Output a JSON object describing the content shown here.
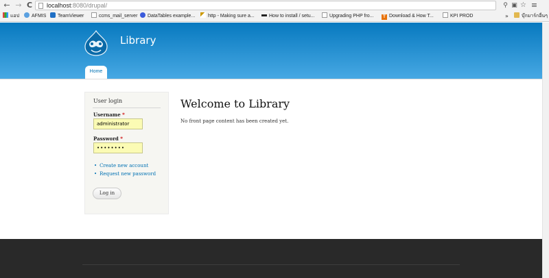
{
  "browser": {
    "url_host": "localhost",
    "url_path": ":8080/drupal/",
    "back_icon": "←",
    "forward_icon": "→",
    "reload_icon": "C",
    "menu_icon": "≡",
    "star_icon": "☆"
  },
  "bookmarks": {
    "items": [
      {
        "label": "แอป",
        "icon": "apps-icon"
      },
      {
        "label": "AFMIS",
        "icon": "drop-icon"
      },
      {
        "label": "TeamViewer",
        "icon": "teamviewer-icon"
      },
      {
        "label": "ccms_mail_server",
        "icon": "page-icon"
      },
      {
        "label": "DataTables example...",
        "icon": "globe-icon"
      },
      {
        "label": "http - Making sure a...",
        "icon": "pen-icon"
      },
      {
        "label": "How to install / setu...",
        "icon": "bar-icon"
      },
      {
        "label": "Upgrading PHP fro...",
        "icon": "page-icon"
      },
      {
        "label": "Download & How T...",
        "icon": "t-icon"
      },
      {
        "label": "KPI PROD",
        "icon": "page-icon"
      }
    ],
    "more": "»",
    "other_label": "บุ๊กมาร์กอื่นๆ"
  },
  "site": {
    "name": "Library",
    "tab_home": "Home"
  },
  "login": {
    "title": "User login",
    "username_label": "Username",
    "username_value": "administrator",
    "password_label": "Password",
    "password_value": "••••••••",
    "required_mark": "*",
    "create_account": "Create new account",
    "request_password": "Request new password",
    "login_button": "Log in"
  },
  "main": {
    "title": "Welcome to Library",
    "text": "No front page content has been created yet."
  },
  "colors": {
    "header_top": "#0779bf",
    "header_bottom": "#48a9e4",
    "link": "#0071b3",
    "footer": "#292929",
    "input_bg": "#fbfbb4"
  }
}
